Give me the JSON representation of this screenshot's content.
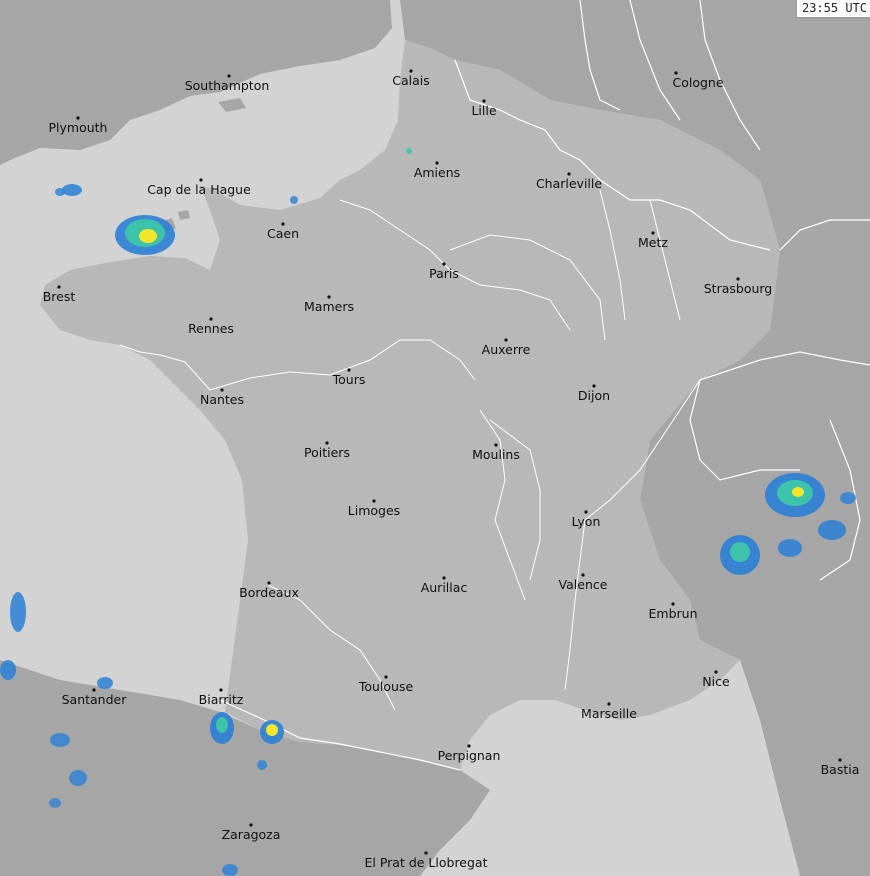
{
  "timestamp": "23:55 UTC",
  "colors": {
    "sea": "#d3d3d3",
    "france": "#b8b8b8",
    "neighbor_land": "#a6a6a6",
    "borders": "#ffffff",
    "rivers": "#ffffff",
    "radar_low": "#2b7fd6",
    "radar_mid": "#3cc6a8",
    "radar_high": "#f2e62a"
  },
  "cities": [
    {
      "name": "Southampton"
    },
    {
      "name": "Calais"
    },
    {
      "name": "Cologne"
    },
    {
      "name": "Plymouth"
    },
    {
      "name": "Lille"
    },
    {
      "name": "Amiens"
    },
    {
      "name": "Charleville"
    },
    {
      "name": "Cap de la Hague"
    },
    {
      "name": "Caen"
    },
    {
      "name": "Metz"
    },
    {
      "name": "Paris"
    },
    {
      "name": "Strasbourg"
    },
    {
      "name": "Brest"
    },
    {
      "name": "Mamers"
    },
    {
      "name": "Rennes"
    },
    {
      "name": "Auxerre"
    },
    {
      "name": "Tours"
    },
    {
      "name": "Dijon"
    },
    {
      "name": "Nantes"
    },
    {
      "name": "Poitiers"
    },
    {
      "name": "Moulins"
    },
    {
      "name": "Limoges"
    },
    {
      "name": "Lyon"
    },
    {
      "name": "Valence"
    },
    {
      "name": "Bordeaux"
    },
    {
      "name": "Aurillac"
    },
    {
      "name": "Embrun"
    },
    {
      "name": "Nice"
    },
    {
      "name": "Santander"
    },
    {
      "name": "Toulouse"
    },
    {
      "name": "Biarritz"
    },
    {
      "name": "Marseille"
    },
    {
      "name": "Perpignan"
    },
    {
      "name": "Bastia"
    },
    {
      "name": "Zaragoza"
    },
    {
      "name": "El Prat de Llobregat"
    }
  ]
}
